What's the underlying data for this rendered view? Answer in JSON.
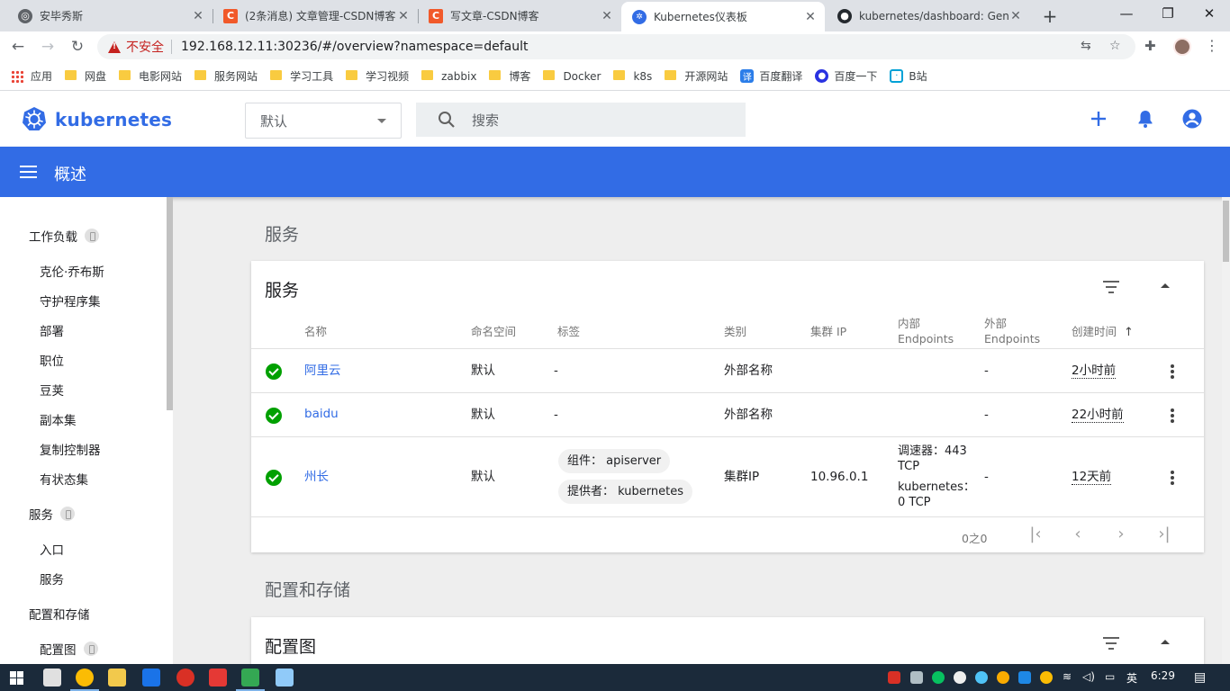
{
  "browser": {
    "tabs": [
      {
        "title": "安毕秀斯",
        "icon": "globe-icon"
      },
      {
        "title": "(2条消息) 文章管理-CSDN博客",
        "icon": "csdn-icon"
      },
      {
        "title": "写文章-CSDN博客",
        "icon": "csdn-icon"
      },
      {
        "title": "Kubernetes仪表板",
        "icon": "kubernetes-icon"
      },
      {
        "title": "kubernetes/dashboard: General-purpose web UI for Kubernetes clusters",
        "icon": "github-icon"
      }
    ],
    "insecure_label": "不安全",
    "url": "192.168.12.11:30236/#/overview?namespace=default",
    "bookmarks": [
      "应用",
      "网盘",
      "电影网站",
      "服务网站",
      "学习工具",
      "学习视频",
      "zabbix",
      "博客",
      "Docker",
      "k8s",
      "开源网站",
      "百度翻译",
      "百度一下",
      "B站"
    ]
  },
  "header": {
    "brand": "kubernetes",
    "namespace_value": "默认",
    "search_placeholder": "搜索"
  },
  "toolbar": {
    "title": "概述"
  },
  "sidebar": {
    "workloads": "工作负载",
    "workload_items": [
      "克伦·乔布斯",
      "守护程序集",
      "部署",
      "职位",
      "豆荚",
      "副本集",
      "复制控制器",
      "有状态集"
    ],
    "services": "服务",
    "service_items": [
      "入口",
      "服务"
    ],
    "config": "配置和存储",
    "config_items": [
      "配置图"
    ]
  },
  "main": {
    "services_section": "服务",
    "services_card_title": "服务",
    "columns": {
      "name": "名称",
      "namespace": "命名空间",
      "labels": "标签",
      "type": "类别",
      "cluster_ip": "集群 IP",
      "internal_l1": "内部",
      "internal_l2": "Endpoints",
      "external_l1": "外部",
      "external_l2": "Endpoints",
      "created": "创建时间"
    },
    "rows": [
      {
        "name": "阿里云",
        "namespace": "默认",
        "labels": "-",
        "type": "外部名称",
        "cluster_ip": "",
        "external": "-",
        "created": "2小时前"
      },
      {
        "name": "baidu",
        "namespace": "默认",
        "labels": "-",
        "type": "外部名称",
        "cluster_ip": "",
        "external": "-",
        "created": "22小时前"
      },
      {
        "name": "州长",
        "namespace": "默认",
        "label_1": "组件： apiserver",
        "label_2": "提供者： kubernetes",
        "type": "集群IP",
        "cluster_ip": "10.96.0.1",
        "internal_1a": "调速器：443",
        "internal_1b": "TCP",
        "internal_2a": "kubernetes：",
        "internal_2b": "0 TCP",
        "external": "-",
        "created": "12天前"
      }
    ],
    "pagination": "0之0",
    "config_section": "配置和存储",
    "config_card_title": "配置图"
  },
  "taskbar": {
    "ime": "英",
    "time": "6:29"
  },
  "colors": {
    "brand": "#326ce5",
    "ok": "#00a000"
  }
}
